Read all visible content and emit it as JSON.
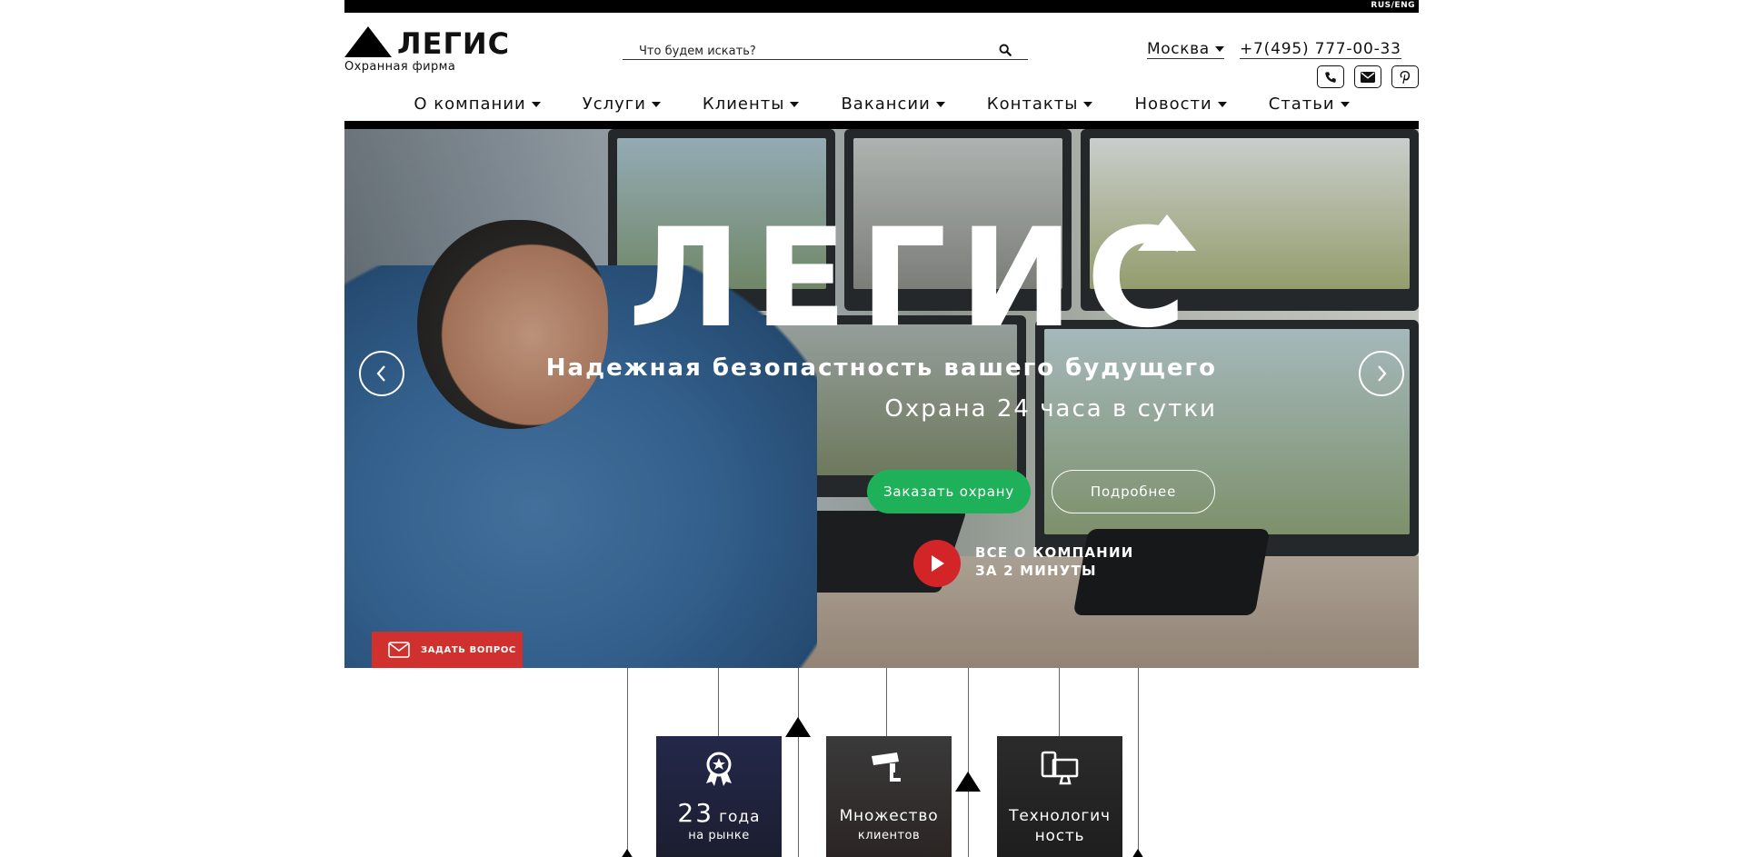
{
  "lang_switch": "RUS/ENG",
  "logo": {
    "name": "ЛЕГИС",
    "subtitle": "Охранная фирма"
  },
  "search": {
    "placeholder": "Что будем искать?",
    "value": ""
  },
  "contacts": {
    "city": "Москва",
    "phone": "+7(495) 777-00-33",
    "icons": [
      "phone-icon",
      "mail-icon",
      "pinterest-icon"
    ]
  },
  "nav": {
    "items": [
      {
        "label": "О компании"
      },
      {
        "label": "Услуги"
      },
      {
        "label": "Клиенты"
      },
      {
        "label": "Вакансии"
      },
      {
        "label": "Контакты"
      },
      {
        "label": "Новости"
      },
      {
        "label": "Статьи"
      }
    ]
  },
  "hero": {
    "title": "ЛЕГИС",
    "subtitle1": "Надежная безопастность вашего будущего",
    "subtitle2": "Охрана 24 часа в сутки",
    "order_button": "Заказать охрану",
    "more_button": "Подробнее",
    "video_line1": "ВСЕ О КОМПАНИИ",
    "video_line2": "ЗА 2 МИНУТЫ",
    "ask_button": "ЗАДАТЬ ВОПРОС"
  },
  "features": [
    {
      "number": "23",
      "unit": "года",
      "caption": "на рынке"
    },
    {
      "title": "Множество",
      "caption": "клиентов"
    },
    {
      "line1": "Технологич",
      "line2": "ность"
    }
  ],
  "colors": {
    "accent_green": "#1fb15a",
    "accent_red": "#d0302e",
    "black": "#000000"
  }
}
